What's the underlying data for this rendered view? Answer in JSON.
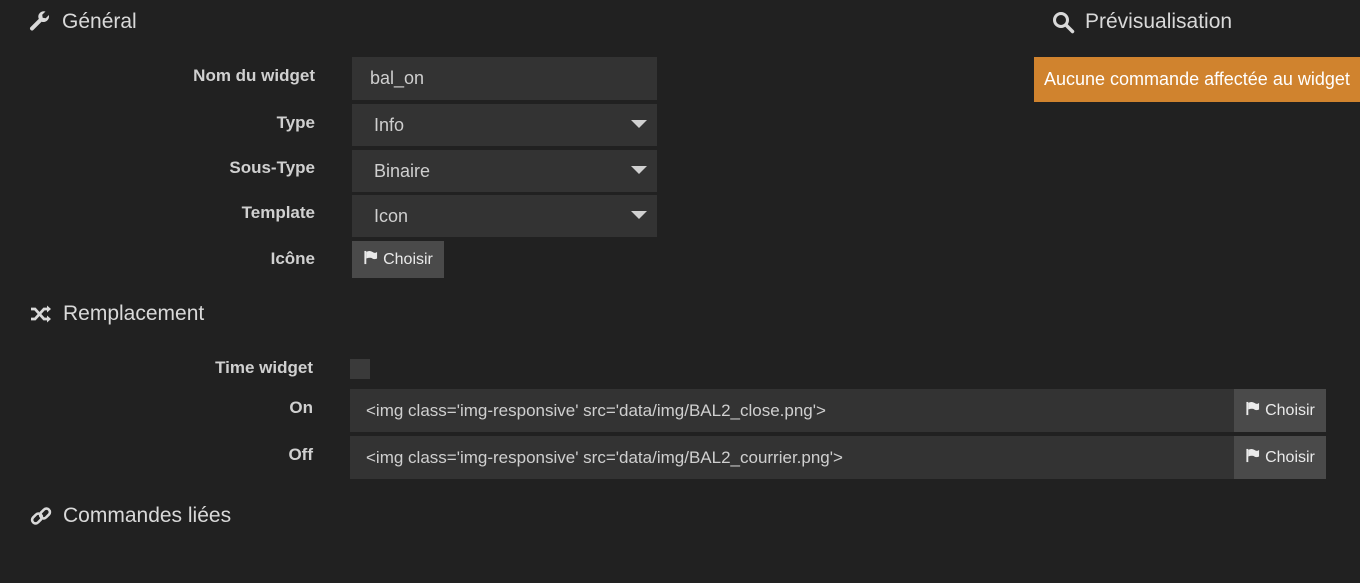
{
  "general": {
    "title": "Général",
    "icon": "wrench-icon"
  },
  "preview": {
    "title": "Prévisualisation",
    "icon": "search-icon",
    "alert": "Aucune commande affectée au widget"
  },
  "form": {
    "name_label": "Nom du widget",
    "name_value": "bal_on",
    "type_label": "Type",
    "type_value": "Info",
    "subtype_label": "Sous-Type",
    "subtype_value": "Binaire",
    "template_label": "Template",
    "template_value": "Icon",
    "icon_label": "Icône",
    "choose_label": "Choisir"
  },
  "replacement": {
    "title": "Remplacement",
    "icon": "shuffle-icon",
    "time_label": "Time widget",
    "time_checked": false,
    "on_label": "On",
    "on_value": "<img class='img-responsive' src='data/img/BAL2_close.png'>",
    "off_label": "Off",
    "off_value": "<img class='img-responsive' src='data/img/BAL2_courrier.png'>",
    "choose_label": "Choisir"
  },
  "linked": {
    "title": "Commandes liées",
    "icon": "link-icon"
  },
  "colors": {
    "background": "#212121",
    "field": "#333333",
    "alert": "#d0832e"
  }
}
